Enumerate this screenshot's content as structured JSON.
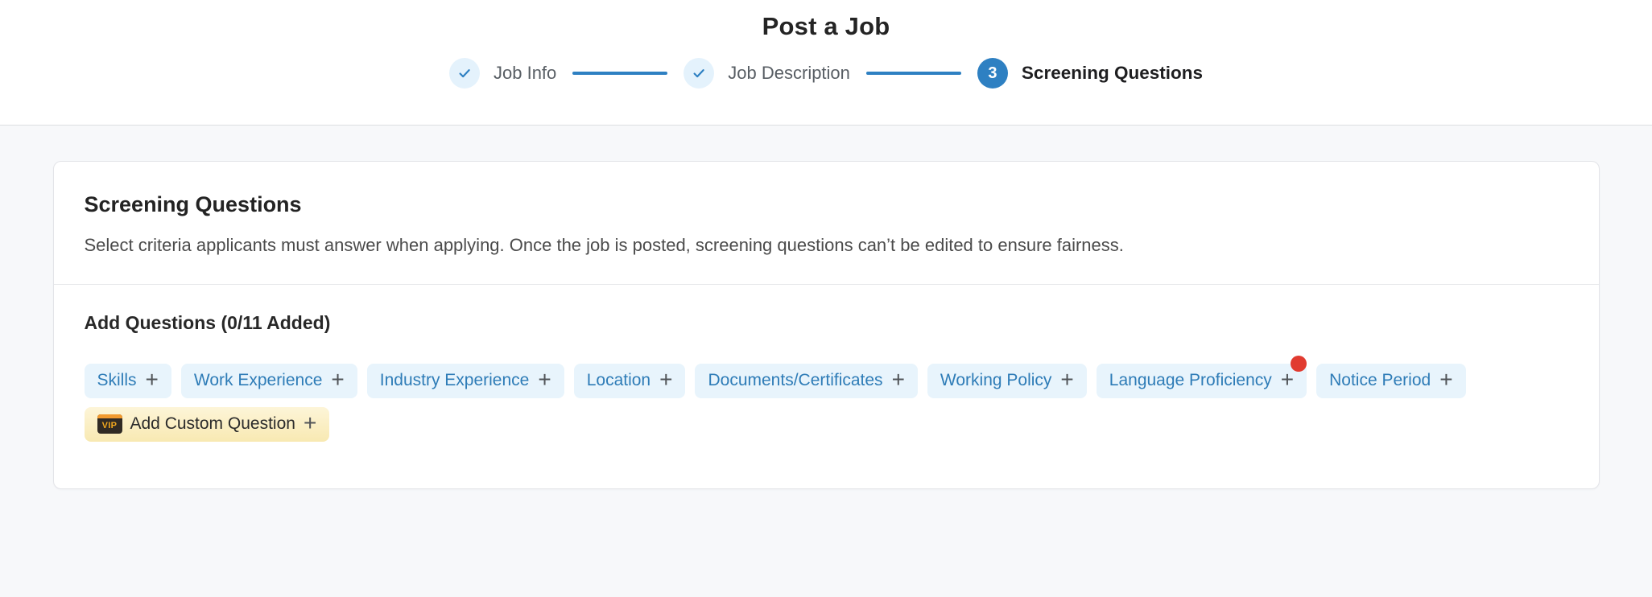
{
  "header": {
    "title": "Post a Job",
    "steps": [
      {
        "label": "Job Info",
        "state": "completed"
      },
      {
        "label": "Job Description",
        "state": "completed"
      },
      {
        "label": "Screening Questions",
        "state": "current",
        "number": "3"
      }
    ]
  },
  "card": {
    "title": "Screening Questions",
    "description": "Select criteria applicants must answer when applying. Once the job is posted, screening questions can’t be edited to ensure fairness.",
    "add_section": {
      "heading": "Add Questions (0/11 Added)",
      "plus_icon": "+",
      "chips": [
        {
          "label": "Skills"
        },
        {
          "label": "Work Experience"
        },
        {
          "label": "Industry Experience"
        },
        {
          "label": "Location"
        },
        {
          "label": "Documents/Certificates"
        },
        {
          "label": "Working Policy"
        },
        {
          "label": "Language Proficiency",
          "notification_dot": true
        },
        {
          "label": "Notice Period"
        }
      ],
      "custom_chip": {
        "label": "Add Custom Question",
        "icon": "vip-badge-icon",
        "icon_text": "VIP"
      }
    }
  },
  "colors": {
    "accent": "#2e80c2",
    "check-circle-bg": "#e4f2fc",
    "chip-bg": "#e8f4fc",
    "chip-text": "#2e7cb7",
    "custom-chip-bg": "#f9eec0",
    "alert-dot": "#e13b30",
    "page-bg": "#f7f8fa"
  }
}
